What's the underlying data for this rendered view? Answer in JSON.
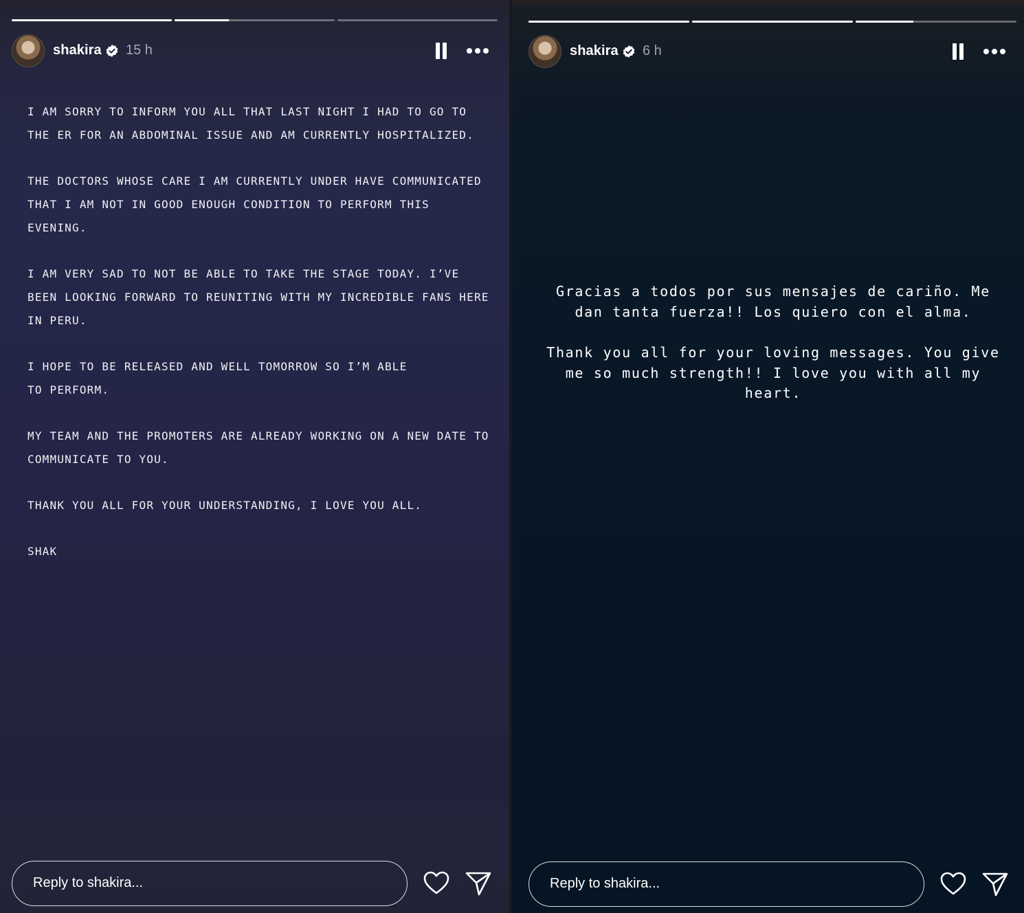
{
  "stories": [
    {
      "username": "shakira",
      "time": "15 h",
      "reply_placeholder": "Reply to shakira...",
      "paragraphs": [
        "I AM SORRY TO INFORM YOU ALL THAT LAST NIGHT I HAD TO GO TO THE ER FOR AN ABDOMINAL ISSUE AND AM CURRENTLY HOSPITALIZED.",
        "THE DOCTORS WHOSE CARE I AM CURRENTLY UNDER HAVE COMMUNICATED THAT I AM NOT IN GOOD ENOUGH CONDITION TO PERFORM THIS EVENING.",
        "I AM VERY SAD TO NOT BE ABLE TO TAKE THE STAGE TODAY. I’VE BEEN LOOKING FORWARD TO REUNITING WITH MY INCREDIBLE FANS HERE IN PERU.",
        "I HOPE TO BE RELEASED AND WELL TOMORROW SO I’M ABLE TO PERFORM.",
        "MY TEAM AND THE PROMOTERS ARE ALREADY WORKING ON A NEW DATE TO COMMUNICATE TO YOU.",
        "THANK YOU ALL FOR YOUR UNDERSTANDING, I LOVE YOU ALL.",
        "SHAK"
      ],
      "progress": [
        1.0,
        0.34,
        0.0
      ]
    },
    {
      "username": "shakira",
      "time": "6 h",
      "reply_placeholder": "Reply to shakira...",
      "paragraphs": [
        "Gracias a todos por sus mensajes de cariño. Me dan tanta fuerza!! Los quiero con el alma.",
        "Thank you all for your loving messages. You give me so much strength!! I love you with all my heart."
      ],
      "progress": [
        1.0,
        1.0,
        0.36
      ]
    }
  ],
  "icons": {
    "verified": "verified-badge-icon",
    "pause": "pause-icon",
    "more": "more-options-icon",
    "heart": "heart-icon",
    "send": "send-icon"
  },
  "colors": {
    "left_bg": "#25284a",
    "right_bg": "#071726",
    "text": "#ffffff"
  }
}
